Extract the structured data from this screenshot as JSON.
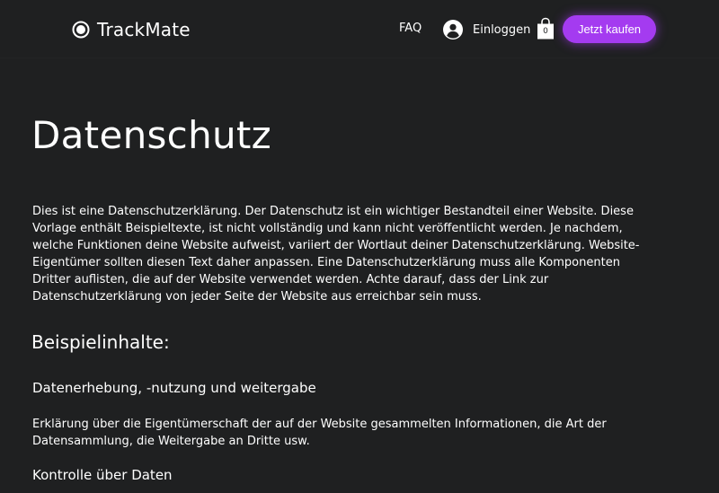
{
  "header": {
    "logo_text": "TrackMate",
    "logo_icon": "record-circle-icon",
    "nav_faq": "FAQ",
    "login_label": "Einloggen",
    "login_icon": "user-avatar-icon",
    "cart_icon": "shopping-bag-icon",
    "cart_count": "0",
    "buy_button": "Jetzt kaufen"
  },
  "main": {
    "title": "Datenschutz",
    "intro": "Dies ist eine Datenschutzerklärung. Der Datenschutz ist ein wichtiger Bestandteil einer Website. Diese Vorlage enthält Beispieltexte, ist nicht vollständig und kann nicht veröffentlicht werden. Je nachdem, welche Funktionen deine Website aufweist, variiert der Wortlaut deiner Datenschutzerklärung. Website-Eigentümer sollten diesen Text daher anpassen. Eine Datenschutzerklärung muss alle Komponenten Dritter auflisten, die auf der Website verwendet werden. Achte darauf, dass der Link zur Datenschutzerklärung von jeder Seite der Website aus erreichbar sein muss.",
    "section_heading": "Beispielinhalte:",
    "subsection_1_heading": "Datenerhebung, -nutzung und weitergabe",
    "subsection_1_text": "Erklärung über die Eigentümerschaft der auf der Website gesammelten Informationen, die Art der Datensammlung, die Weitergabe an Dritte usw.",
    "subsection_2_heading": "Kontrolle über Daten"
  },
  "colors": {
    "background": "#1f2021",
    "accent": "#a43bf0",
    "text": "#ffffff"
  }
}
